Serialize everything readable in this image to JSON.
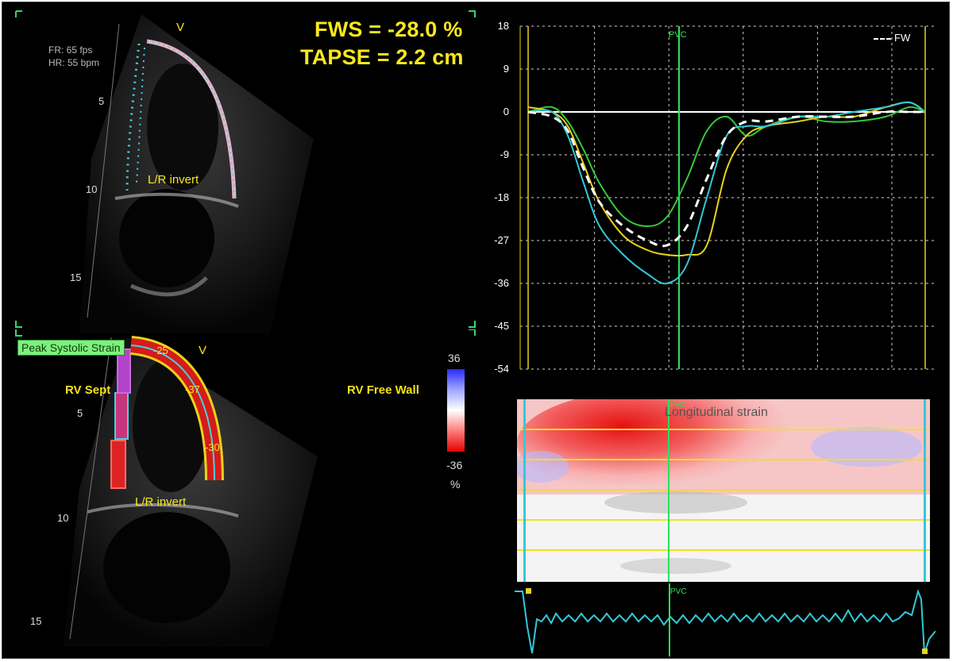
{
  "top_echo": {
    "frame_rate": "FR: 65 fps",
    "heart_rate": "HR: 55 bpm",
    "depth_marks": [
      "5",
      "10",
      "15"
    ],
    "apex_label": "V",
    "orientation": "L/R invert"
  },
  "measurements": {
    "fws": "FWS = -28.0 %",
    "tapse": "TAPSE = 2.2 cm"
  },
  "strain_chart": {
    "legend": "FW",
    "marker": "PVC",
    "y_ticks": [
      "18",
      "9",
      "0",
      "-9",
      "-18",
      "-27",
      "-36",
      "-45",
      "-54"
    ]
  },
  "bottom_echo": {
    "peak_label": "Peak Systolic Strain",
    "septal_label": "RV Sept",
    "free_wall_label": "RV Free Wall",
    "apex_label": "V",
    "orientation": "L/R invert",
    "depth_marks": [
      "5",
      "10",
      "15"
    ],
    "segment_values": [
      "-25",
      "-37",
      "-30"
    ]
  },
  "color_scale": {
    "max": "36",
    "min": "-36",
    "unit": "%"
  },
  "strain_map": {
    "title": "Longitudinal strain",
    "marker": "PVC"
  },
  "ecg": {
    "marker": "PVC"
  },
  "colors": {
    "background": "#000000",
    "label_yellow": "#f7e81c",
    "marker_green": "#2ee05a",
    "cyan_trace": "#33c9d6",
    "yellow_trace": "#e8d21a",
    "green_trace": "#35c93a",
    "mean_trace": "#ffffff"
  },
  "chart_data": {
    "type": "line",
    "ylim": [
      -54,
      18
    ],
    "y_ticks": [
      18,
      9,
      0,
      -9,
      -18,
      -27,
      -36,
      -45,
      -54
    ],
    "legend_position": "top-right",
    "grid": true,
    "series": [
      {
        "name": "FW",
        "style": "dashed-white",
        "x": [
          0,
          0.06,
          0.1,
          0.14,
          0.18,
          0.24,
          0.3,
          0.35,
          0.4,
          0.45,
          0.5,
          0.55,
          0.6,
          0.68,
          0.75,
          0.82,
          0.9,
          0.96,
          1.0
        ],
        "y": [
          0,
          -1,
          -4,
          -12,
          -19,
          -24,
          -27,
          -28,
          -24,
          -14,
          -5,
          -2,
          -2,
          -1,
          -1,
          -1,
          0,
          0,
          0
        ]
      },
      {
        "style": "cyan",
        "x": [
          0,
          0.06,
          0.1,
          0.14,
          0.18,
          0.24,
          0.3,
          0.35,
          0.4,
          0.45,
          0.5,
          0.55,
          0.6,
          0.68,
          0.75,
          0.82,
          0.9,
          0.96,
          1.0
        ],
        "y": [
          0,
          0,
          -5,
          -15,
          -24,
          -30,
          -34,
          -36,
          -32,
          -18,
          -5,
          -3,
          -3,
          -1,
          -1,
          0,
          1,
          2,
          0
        ]
      },
      {
        "style": "yellow",
        "x": [
          0,
          0.06,
          0.1,
          0.14,
          0.18,
          0.24,
          0.3,
          0.35,
          0.4,
          0.45,
          0.5,
          0.55,
          0.6,
          0.68,
          0.75,
          0.82,
          0.9,
          0.96,
          1.0
        ],
        "y": [
          1,
          0,
          -3,
          -11,
          -19,
          -26,
          -29,
          -30,
          -30,
          -28,
          -12,
          -5,
          -3,
          -2,
          -1,
          -1,
          1,
          2,
          0
        ]
      },
      {
        "style": "green",
        "x": [
          0,
          0.06,
          0.1,
          0.14,
          0.18,
          0.24,
          0.3,
          0.35,
          0.4,
          0.45,
          0.5,
          0.55,
          0.6,
          0.68,
          0.75,
          0.82,
          0.9,
          0.96,
          1.0
        ],
        "y": [
          0,
          1,
          -2,
          -8,
          -15,
          -22,
          -24,
          -22,
          -14,
          -4,
          -1,
          -5,
          -3,
          -1,
          -2,
          -2,
          -1,
          1,
          0
        ]
      }
    ]
  }
}
